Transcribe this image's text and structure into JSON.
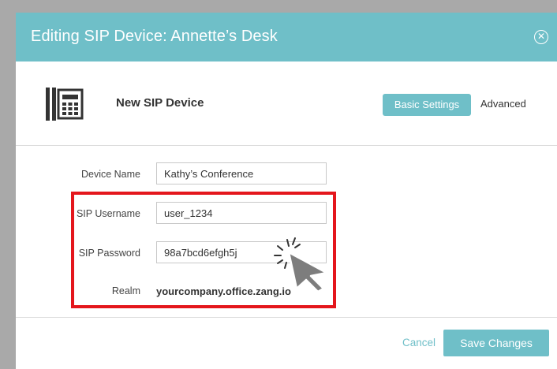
{
  "dialog": {
    "title": "Editing SIP Device: Annette’s Desk",
    "close_icon": "close-circle-icon"
  },
  "header": {
    "device_icon": "desk-phone-icon",
    "heading": "New SIP Device"
  },
  "tabs": {
    "basic": "Basic Settings",
    "advanced": "Advanced"
  },
  "form": {
    "device_name": {
      "label": "Device Name",
      "value": "Kathy’s Conference"
    },
    "sip_username": {
      "label": "SIP Username",
      "value": "user_1234"
    },
    "sip_password": {
      "label": "SIP Password",
      "value": "98a7bcd6efgh5j"
    },
    "realm": {
      "label": "Realm",
      "value": "yourcompany.office.zang.io"
    }
  },
  "footer": {
    "cancel_label": "Cancel",
    "save_label": "Save Changes"
  },
  "colors": {
    "accent": "#6fbfc8",
    "highlight": "#e4161c"
  }
}
